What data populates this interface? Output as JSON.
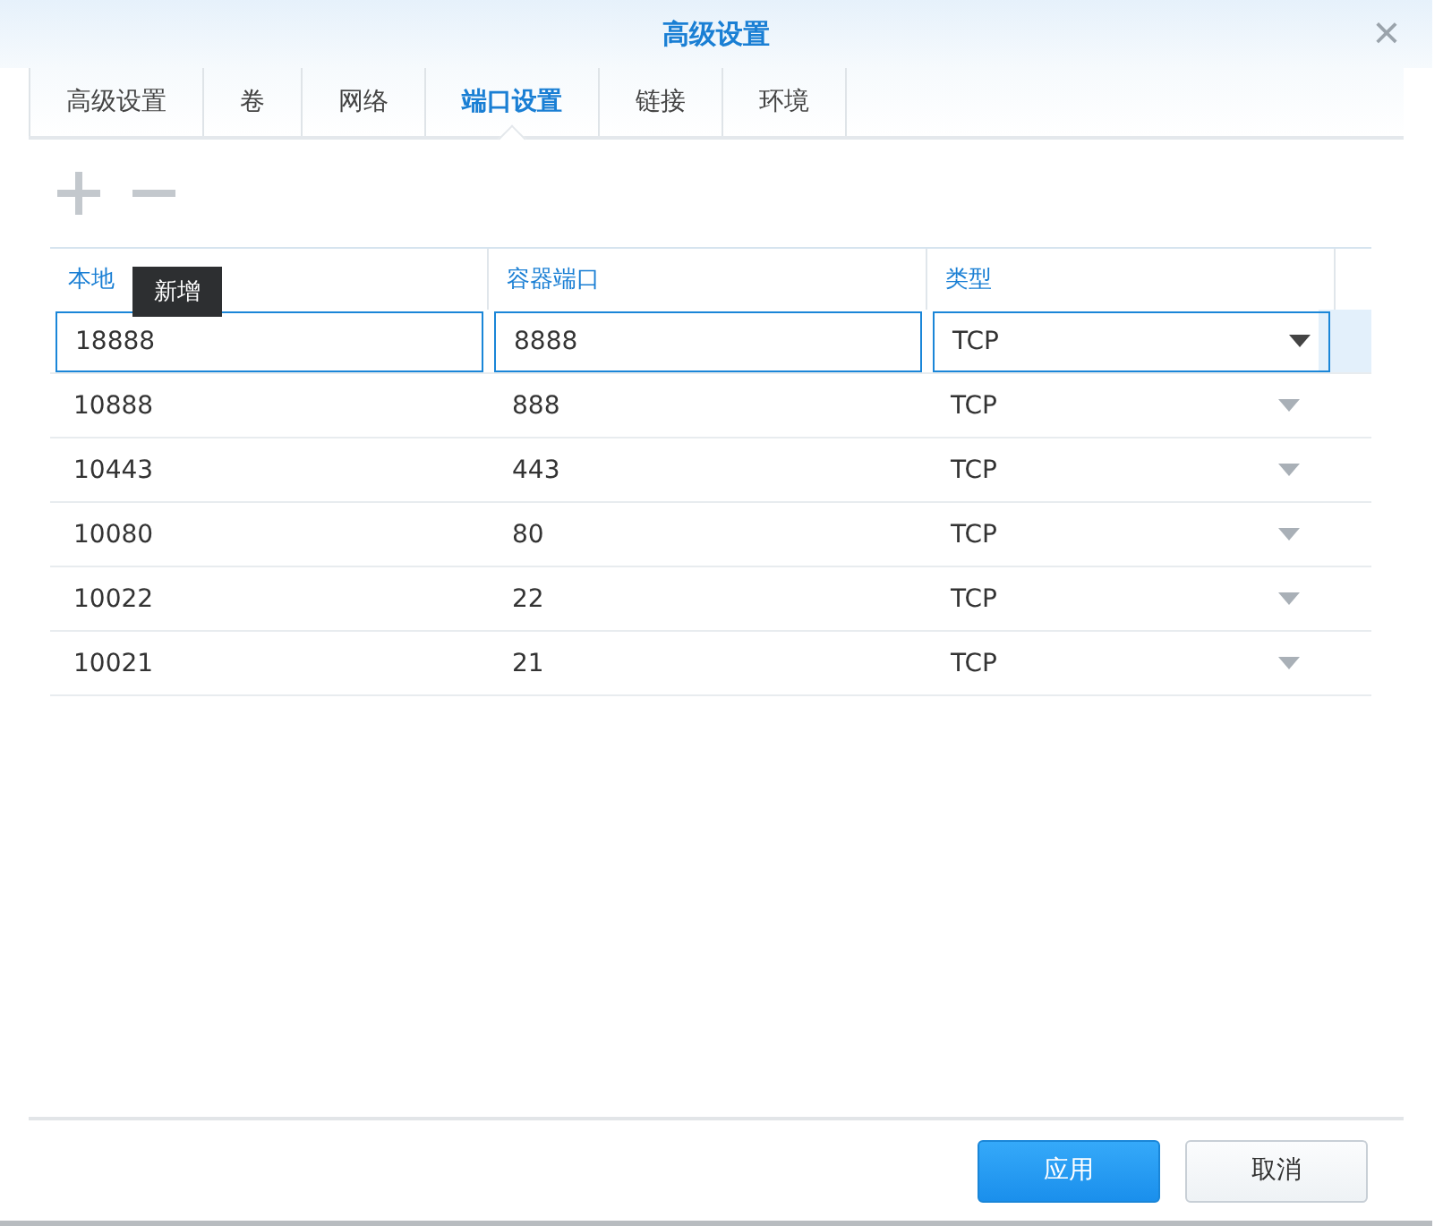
{
  "window": {
    "title": "高级设置",
    "close": "×"
  },
  "tabs": [
    {
      "label": "高级设置",
      "selected": false
    },
    {
      "label": "卷",
      "selected": false
    },
    {
      "label": "网络",
      "selected": false
    },
    {
      "label": "端口设置",
      "selected": true
    },
    {
      "label": "链接",
      "selected": false
    },
    {
      "label": "环境",
      "selected": false
    }
  ],
  "toolbar": {
    "tooltip": "新增"
  },
  "table": {
    "columns": [
      "本地",
      "容器端口",
      "类型"
    ],
    "rows": [
      {
        "local": "18888",
        "container": "8888",
        "type": "TCP",
        "editing": true
      },
      {
        "local": "10888",
        "container": "888",
        "type": "TCP",
        "editing": false
      },
      {
        "local": "10443",
        "container": "443",
        "type": "TCP",
        "editing": false
      },
      {
        "local": "10080",
        "container": "80",
        "type": "TCP",
        "editing": false
      },
      {
        "local": "10022",
        "container": "22",
        "type": "TCP",
        "editing": false
      },
      {
        "local": "10021",
        "container": "21",
        "type": "TCP",
        "editing": false
      }
    ]
  },
  "buttons": [
    {
      "label": "应用",
      "kind": "primary"
    },
    {
      "label": "取消",
      "kind": "secondary"
    }
  ]
}
